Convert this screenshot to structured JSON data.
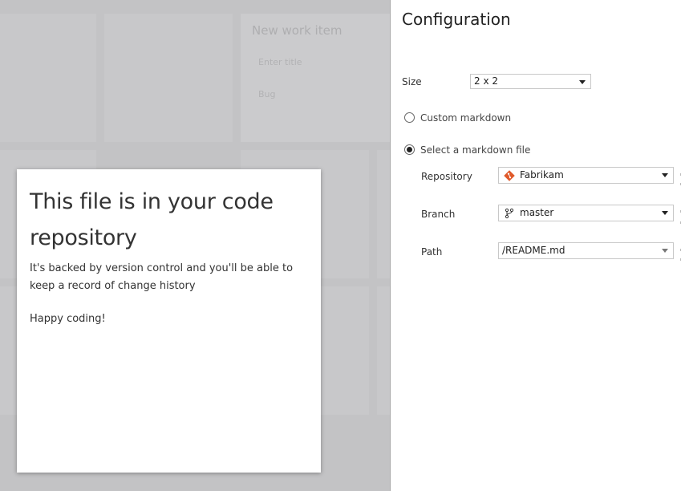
{
  "dashboard": {
    "work_item_widget": {
      "title": "New work item",
      "title_placeholder": "Enter title",
      "type_value": "Bug"
    }
  },
  "markdown_card": {
    "heading": "This file is in your code repository",
    "paragraph1": "It's backed by version control and you'll be able to keep a record of change history",
    "paragraph2": "Happy coding!"
  },
  "config": {
    "title": "Configuration",
    "size": {
      "label": "Size",
      "value": "2 x 2"
    },
    "custom_markdown": {
      "label": "Custom markdown",
      "selected": false
    },
    "select_file": {
      "label": "Select a markdown file",
      "selected": true
    },
    "repository": {
      "label": "Repository",
      "value": "Fabrikam",
      "icon": "git-repo-icon",
      "icon_color": "#e05a2b"
    },
    "branch": {
      "label": "Branch",
      "value": "master",
      "icon": "git-branch-icon"
    },
    "path": {
      "label": "Path",
      "value": "/README.md"
    }
  }
}
